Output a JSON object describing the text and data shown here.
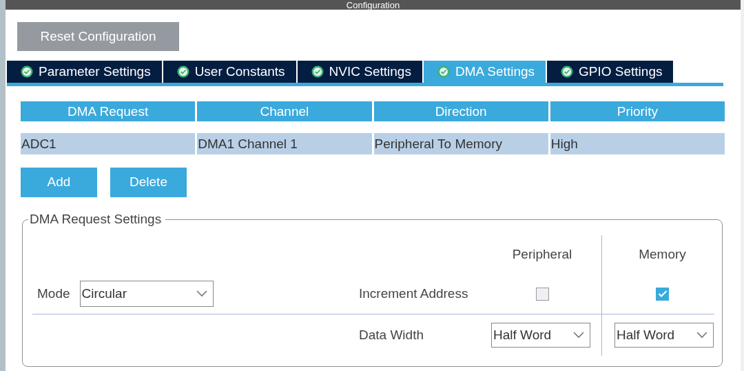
{
  "window": {
    "title": "Configuration"
  },
  "toolbar": {
    "reset_button": "Reset Configuration"
  },
  "tabs": [
    {
      "label": "Parameter Settings",
      "selected": false
    },
    {
      "label": "User Constants",
      "selected": false
    },
    {
      "label": "NVIC Settings",
      "selected": false
    },
    {
      "label": "DMA Settings",
      "selected": true
    },
    {
      "label": "GPIO Settings",
      "selected": false
    }
  ],
  "dma_table": {
    "columns": [
      "DMA Request",
      "Channel",
      "Direction",
      "Priority"
    ],
    "rows": [
      {
        "cells": [
          "ADC1",
          "DMA1 Channel 1",
          "Peripheral To Memory",
          "High"
        ],
        "selected": true
      }
    ]
  },
  "actions": [
    "Add",
    "Delete"
  ],
  "request_settings": {
    "title": "DMA Request Settings",
    "mode": {
      "label": "Mode",
      "value": "Circular"
    },
    "column_headers": [
      "Peripheral",
      "Memory"
    ],
    "increment_address": {
      "label": "Increment Address",
      "peripheral_checked": false,
      "memory_checked": true
    },
    "data_width": {
      "label": "Data Width",
      "peripheral": "Half Word",
      "memory": "Half Word"
    }
  }
}
